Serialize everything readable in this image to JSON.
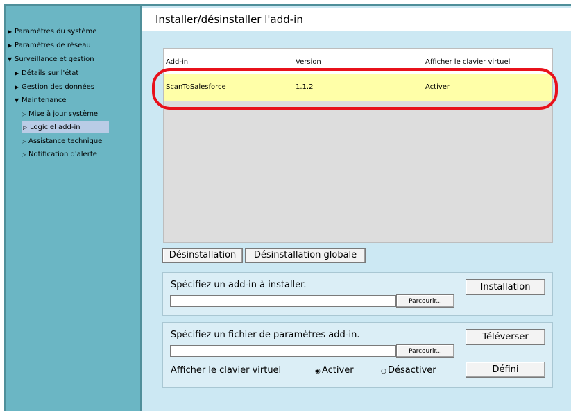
{
  "page_title": "Installer/désinstaller l'add-in",
  "sidebar": {
    "items": [
      {
        "label": "Paramètres du système",
        "arrow": "▶"
      },
      {
        "label": "Paramètres de réseau",
        "arrow": "▶"
      },
      {
        "label": "Surveillance et gestion",
        "arrow": "▼"
      },
      {
        "label": "Détails sur l'état",
        "arrow": "▶"
      },
      {
        "label": "Gestion des données",
        "arrow": "▶"
      },
      {
        "label": "Maintenance",
        "arrow": "▼"
      },
      {
        "label": "Mise à jour système",
        "arrow": "▷"
      },
      {
        "label": "Logiciel add-in",
        "arrow": "▷"
      },
      {
        "label": "Assistance technique",
        "arrow": "▷"
      },
      {
        "label": "Notification d'alerte",
        "arrow": "▷"
      }
    ]
  },
  "table": {
    "headers": [
      "Add-in",
      "Version",
      "Afficher le clavier virtuel"
    ],
    "rows": [
      [
        "ScanToSalesforce",
        "1.1.2",
        "Activer"
      ]
    ]
  },
  "buttons": {
    "uninstall": "Désinstallation",
    "uninstall_all": "Désinstallation globale",
    "install": "Installation",
    "browse": "Parcourir...",
    "upload": "Téléverser",
    "set": "Défini"
  },
  "install_panel": {
    "prompt": "Spécifiez un add-in à installer.",
    "file_value": ""
  },
  "settings_panel": {
    "prompt": "Spécifiez un fichier de paramètres add-in.",
    "file_value": "",
    "keyboard_label": "Afficher le clavier virtuel",
    "radio_on": "Activer",
    "radio_off": "Désactiver",
    "selected": "Activer"
  },
  "colors": {
    "highlight": "#e8111b",
    "selected_row": "#ffffa8",
    "sidebar": "#6bb6c4",
    "main": "#cce8f3"
  }
}
